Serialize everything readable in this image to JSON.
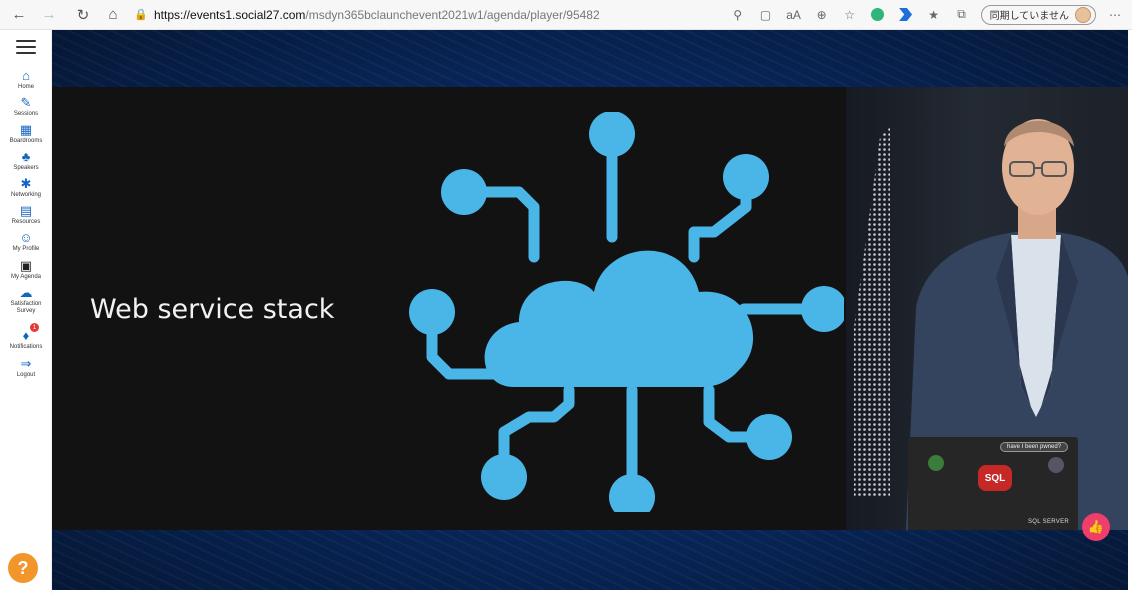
{
  "browser": {
    "url_host": "https://events1.social27.com",
    "url_path": "/msdyn365bclaunchevent2021w1/agenda/player/95482",
    "sync_label": "同期していません"
  },
  "sidebar": {
    "items": [
      {
        "label": "Home",
        "icon": "home-icon"
      },
      {
        "label": "Sessions",
        "icon": "pencil-icon"
      },
      {
        "label": "Boardrooms",
        "icon": "boardroom-icon"
      },
      {
        "label": "Speakers",
        "icon": "speaker-icon"
      },
      {
        "label": "Networking",
        "icon": "networking-icon"
      },
      {
        "label": "Resources",
        "icon": "resources-icon"
      },
      {
        "label": "My Profile",
        "icon": "profile-icon"
      },
      {
        "label": "My Agenda",
        "icon": "calendar-icon"
      },
      {
        "label": "Satisfaction Survey",
        "icon": "survey-icon"
      },
      {
        "label": "Notifications",
        "icon": "bell-icon"
      },
      {
        "label": "Logout",
        "icon": "logout-icon"
      }
    ],
    "notification_count": "1",
    "help_label": "?"
  },
  "slide": {
    "title": "Web service stack"
  },
  "speaker_video": {
    "laptop_bubble": "have I been pwned?",
    "laptop_sticker_sql": "SQL",
    "laptop_sticker_server": "SQL SERVER"
  },
  "colors": {
    "accent": "#1565c0",
    "cloud": "#4ab6e8",
    "like": "#ee3e6a",
    "help": "#f2952b"
  }
}
